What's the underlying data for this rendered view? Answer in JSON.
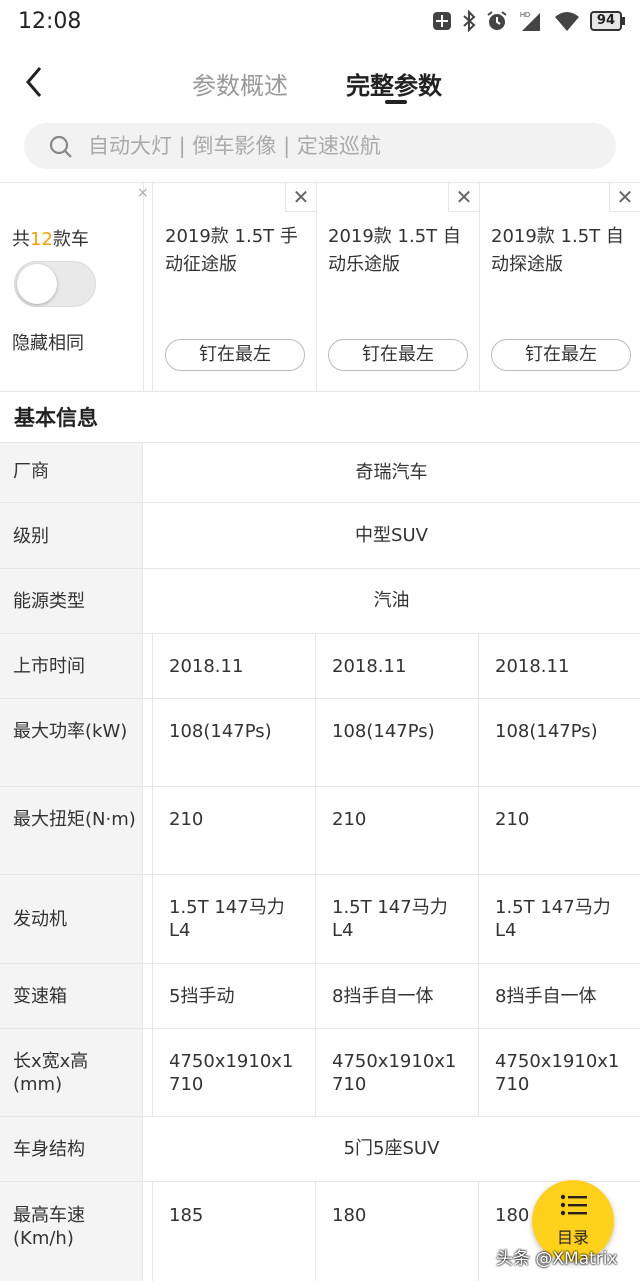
{
  "status_bar": {
    "time": "12:08",
    "battery": "94"
  },
  "header": {
    "tab_summary": "参数概述",
    "tab_full": "完整参数"
  },
  "search": {
    "placeholder": "自动大灯 | 倒车影像 | 定速巡航"
  },
  "filter": {
    "count_prefix": "共",
    "count": "12",
    "count_suffix": "款车",
    "hide_same_label": "隐藏相同"
  },
  "models": [
    {
      "name": "2019款 1.5T 手动征途版",
      "pin_label": "钉在最左"
    },
    {
      "name": "2019款 1.5T 自动乐途版",
      "pin_label": "钉在最左"
    },
    {
      "name": "2019款 1.5T 自动探途版",
      "pin_label": "钉在最左"
    }
  ],
  "section": {
    "title": "基本信息"
  },
  "rows": [
    {
      "label": "厂商",
      "merged": "奇瑞汽车"
    },
    {
      "label": "级别",
      "merged": "中型SUV"
    },
    {
      "label": "能源类型",
      "merged": "汽油"
    },
    {
      "label": "上市时间",
      "values": [
        "2018.11",
        "2018.11",
        "2018.11"
      ]
    },
    {
      "label": "最大功率(kW)",
      "values": [
        "108(147Ps)",
        "108(147Ps)",
        "108(147Ps)"
      ]
    },
    {
      "label": "最大扭矩(N·m)",
      "values": [
        "210",
        "210",
        "210"
      ]
    },
    {
      "label": "发动机",
      "values": [
        "1.5T 147马力 L4",
        "1.5T 147马力 L4",
        "1.5T 147马力 L4"
      ]
    },
    {
      "label": "变速箱",
      "values": [
        "5挡手动",
        "8挡手自一体",
        "8挡手自一体"
      ]
    },
    {
      "label": "长x宽x高(mm)",
      "values": [
        "4750x1910x1710",
        "4750x1910x1710",
        "4750x1910x1710"
      ]
    },
    {
      "label": "车身结构",
      "merged": "5门5座SUV"
    },
    {
      "label": "最高车速(Km/h)",
      "values": [
        "185",
        "180",
        "180"
      ]
    }
  ],
  "fab": {
    "label": "目录"
  },
  "watermark": "头条 @XMatrix"
}
